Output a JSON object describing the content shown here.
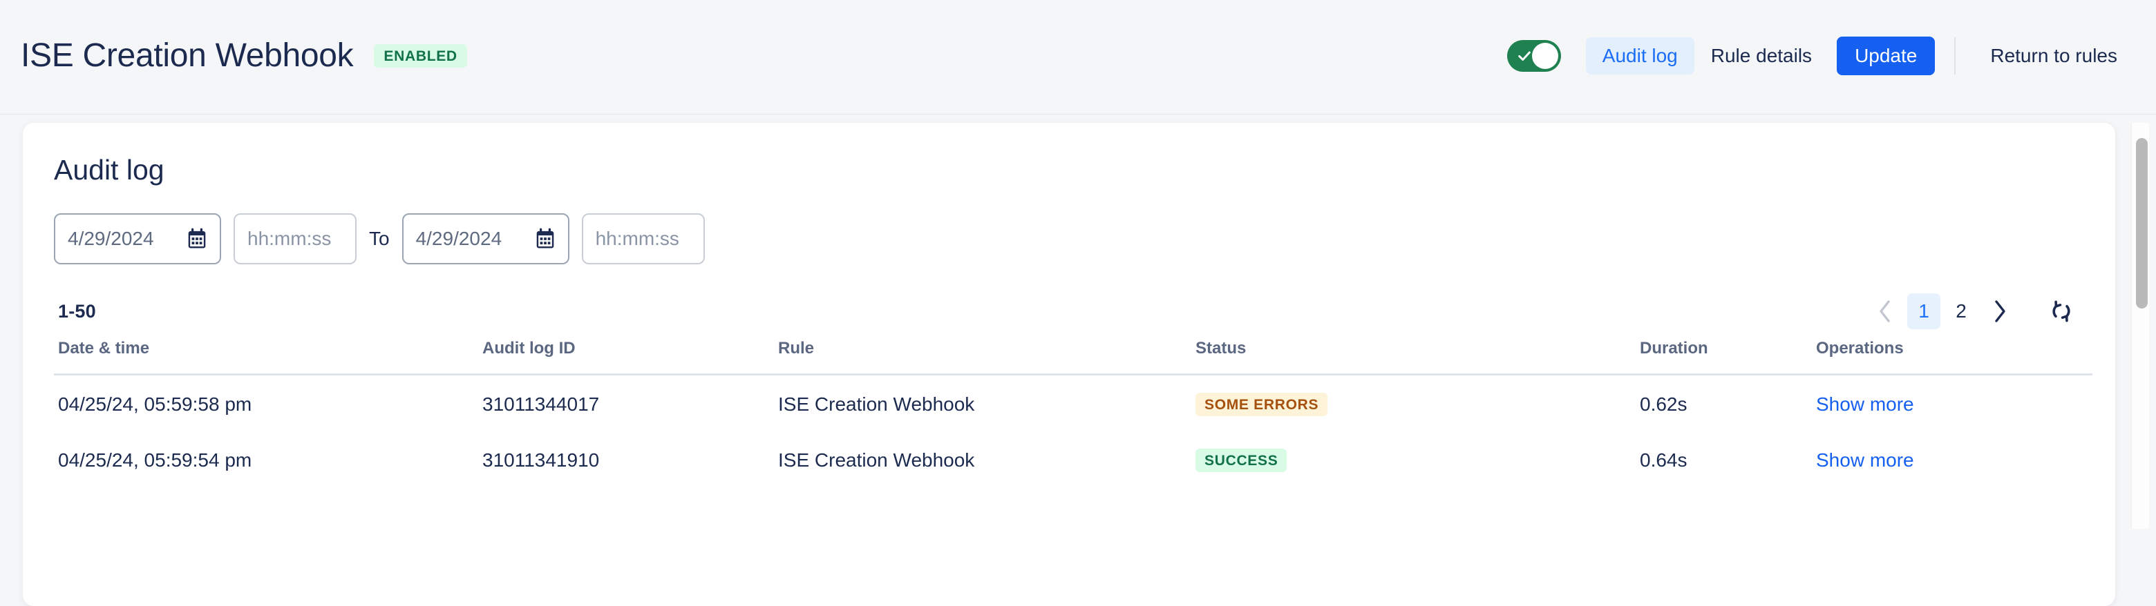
{
  "header": {
    "title": "ISE Creation Webhook",
    "status_chip": "ENABLED",
    "toggle": {
      "name": "enabled-toggle",
      "state": "on"
    },
    "actions": {
      "audit_log": "Audit log",
      "rule_details": "Rule details",
      "update": "Update",
      "return_to_rules": "Return to rules"
    }
  },
  "card": {
    "title": "Audit log",
    "filters": {
      "from_date_value": "4/29/2024",
      "from_time_placeholder": "hh:mm:ss",
      "to_label": "To",
      "to_date_value": "4/29/2024",
      "to_time_placeholder": "hh:mm:ss"
    },
    "pagination": {
      "range": "1-50",
      "prev_icon": "chevron-left-icon",
      "next_icon": "chevron-right-icon",
      "refresh_icon": "refresh-icon",
      "pages": [
        "1",
        "2"
      ],
      "current_page": "1"
    },
    "table": {
      "columns": [
        "Date & time",
        "Audit log ID",
        "Rule",
        "Status",
        "Duration",
        "Operations"
      ],
      "rows": [
        {
          "datetime": "04/25/24, 05:59:58 pm",
          "audit_log_id": "31011344017",
          "rule": "ISE Creation Webhook",
          "status": "SOME ERRORS",
          "status_kind": "warn",
          "duration": "0.62s",
          "operation": "Show more"
        },
        {
          "datetime": "04/25/24, 05:59:54 pm",
          "audit_log_id": "31011341910",
          "rule": "ISE Creation Webhook",
          "status": "SUCCESS",
          "status_kind": "success",
          "duration": "0.64s",
          "operation": "Show more"
        }
      ]
    }
  },
  "colors": {
    "accent_blue": "#1560f0",
    "link_blue": "#1a72f6",
    "success_green": "#12714a",
    "success_bg": "#d9fbe6",
    "warn_text": "#a6500e",
    "warn_bg": "#fdf3d9",
    "toggle_on": "#1f8150",
    "text_navy": "#1b2a4e",
    "page_bg": "#f5f6f8"
  }
}
